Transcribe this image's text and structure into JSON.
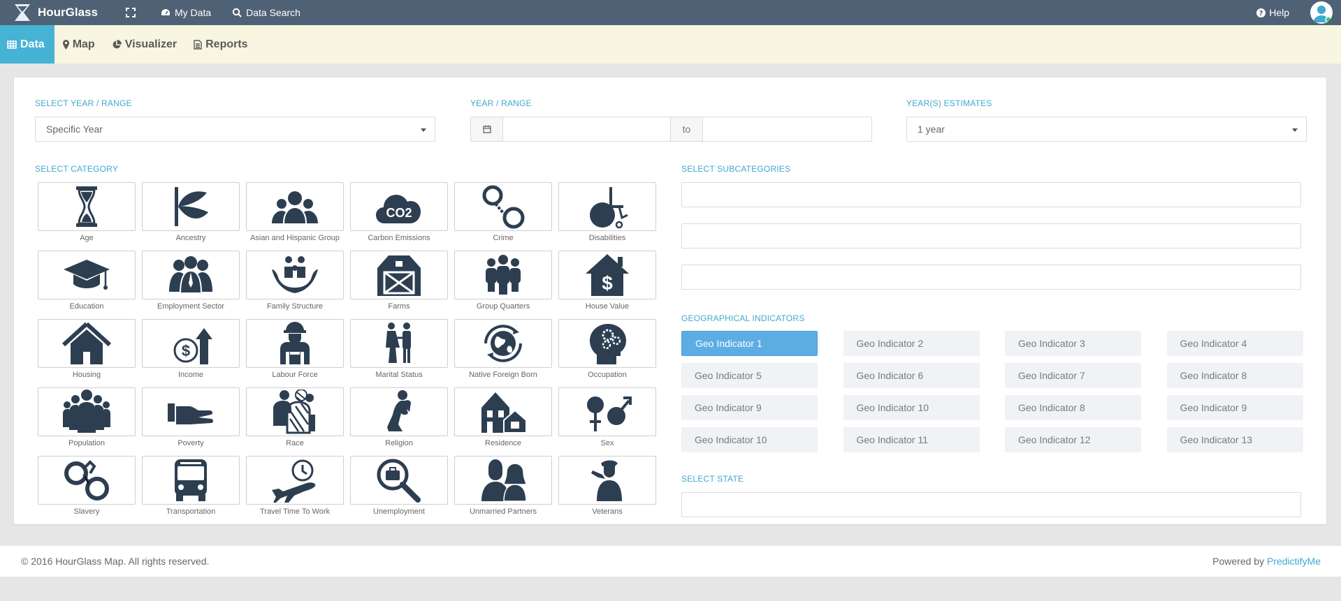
{
  "app": {
    "name": "HourGlass"
  },
  "topnav": {
    "my_data": "My Data",
    "data_search": "Data Search",
    "help": "Help"
  },
  "tabs": [
    {
      "label": "Data",
      "icon": "table-icon"
    },
    {
      "label": "Map",
      "icon": "map-marker-icon"
    },
    {
      "label": "Visualizer",
      "icon": "pie-chart-icon"
    },
    {
      "label": "Reports",
      "icon": "file-text-icon"
    }
  ],
  "filters": {
    "year_range_label": "SELECT YEAR / RANGE",
    "year_range_value": "Specific Year",
    "range_label": "YEAR / RANGE",
    "range_to": "to",
    "estimates_label": "YEAR(S) ESTIMATES",
    "estimates_value": "1 year"
  },
  "category_label": "SELECT CATEGORY",
  "categories": [
    "Age",
    "Ancestry",
    "Asian and Hispanic Group",
    "Carbon Emissions",
    "Crime",
    "Disabilities",
    "Education",
    "Employment Sector",
    "Family Structure",
    "Farms",
    "Group Quarters",
    "House Value",
    "Housing",
    "Income",
    "Labour Force",
    "Marital Status",
    "Native Foreign Born",
    "Occupation",
    "Population",
    "Poverty",
    "Race",
    "Religion",
    "Residence",
    "Sex",
    "Slavery",
    "Transportation",
    "Travel Time To Work",
    "Unemployment",
    "Unmarried Partners",
    "Veterans"
  ],
  "carbon_text": "CO2",
  "subcategories_label": "SELECT SUBCATEGORIES",
  "geo_label": "GEOGRAPHICAL INDICATORS",
  "geo_indicators": [
    "Geo Indicator 1",
    "Geo Indicator 2",
    "Geo Indicator 3",
    "Geo Indicator 4",
    "Geo Indicator 5",
    "Geo Indicator 6",
    "Geo Indicator 7",
    "Geo Indicator 8",
    "Geo Indicator 9",
    "Geo Indicator 10",
    "Geo Indicator 8",
    "Geo Indicator 9",
    "Geo Indicator 10",
    "Geo Indicator 11",
    "Geo Indicator 12",
    "Geo Indicator 13"
  ],
  "state_label": "SELECT STATE",
  "footer": {
    "copyright": "© 2016 HourGlass Map. All rights reserved.",
    "powered_by": "Powered by",
    "powered_link": "PredictifyMe"
  },
  "colors": {
    "topbar": "#4f6175",
    "subnav": "#f8f5e0",
    "accent": "#46b3d5",
    "active_geo": "#5dade5",
    "icon": "#2d3e50"
  }
}
